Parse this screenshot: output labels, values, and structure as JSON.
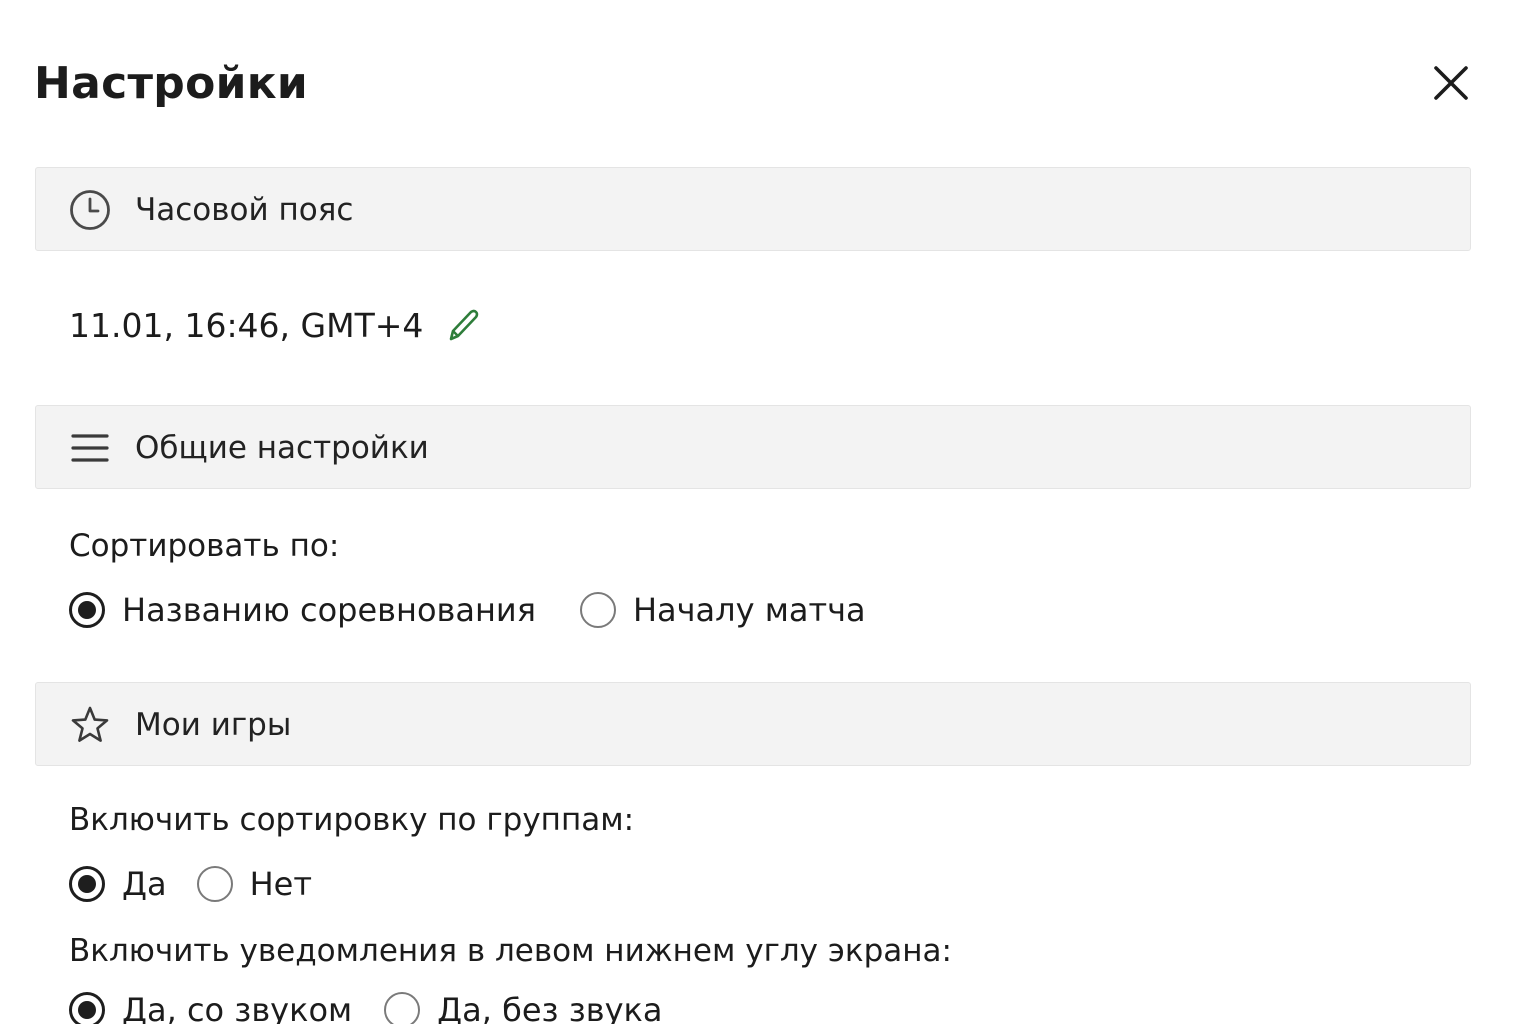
{
  "dialog": {
    "title": "Настройки"
  },
  "timezone_section": {
    "header": "Часовой пояс",
    "icon": "clock-icon",
    "value": "11.01, 16:46, GMT+4",
    "edit_icon": "pencil-icon",
    "accent_color": "#2e7d3a"
  },
  "general_section": {
    "header": "Общие настройки",
    "icon": "menu-icon",
    "sort_label": "Сортировать по:",
    "sort_options": [
      {
        "label": "Названию соревнования",
        "checked": true
      },
      {
        "label": "Началу матча",
        "checked": false
      }
    ]
  },
  "my_games_section": {
    "header": "Мои игры",
    "icon": "star-icon",
    "group_sort_label": "Включить сортировку по группам:",
    "group_sort_options": [
      {
        "label": "Да",
        "checked": true
      },
      {
        "label": "Нет",
        "checked": false
      }
    ],
    "notifications_label": "Включить уведомления в левом нижнем углу экрана:",
    "notifications_options": [
      {
        "label": "Да, со звуком",
        "checked": true
      },
      {
        "label": "Да, без звука",
        "checked": false
      }
    ]
  }
}
